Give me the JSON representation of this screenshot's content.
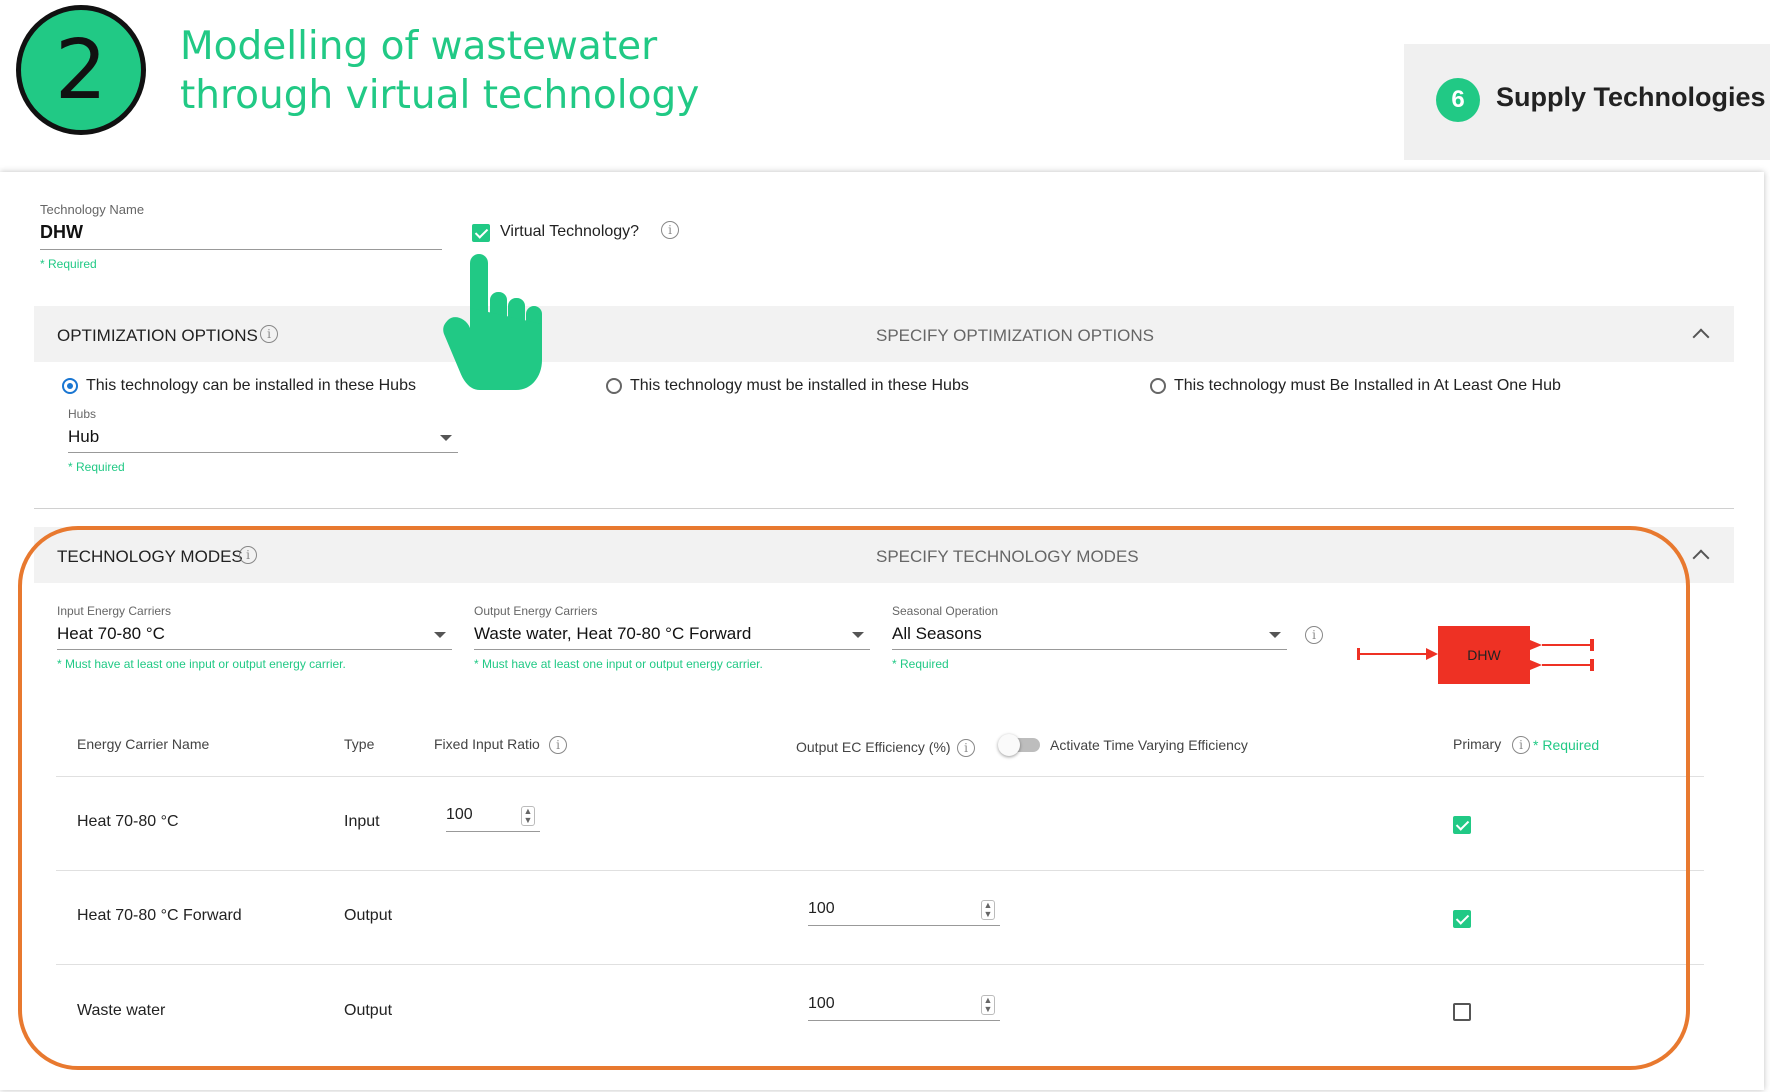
{
  "banner": {
    "step_number": "2",
    "title_line1": "Modelling of wastewater",
    "title_line2": "through virtual technology",
    "section_number": "6",
    "section_label": "Supply Technologies"
  },
  "technology": {
    "name_label": "Technology Name",
    "name_value": "DHW",
    "required": "* Required",
    "virtual_label": "Virtual Technology?",
    "virtual_checked": true
  },
  "optimization": {
    "title": "OPTIMIZATION OPTIONS",
    "center_label": "SPECIFY OPTIMIZATION OPTIONS",
    "options": [
      "This technology can be installed in these Hubs",
      "This technology must be installed in these Hubs",
      "This technology must Be Installed in At Least One Hub"
    ],
    "selected_option": 0,
    "hubs_label": "Hubs",
    "hubs_value": "Hub",
    "required": "* Required"
  },
  "modes": {
    "title": "TECHNOLOGY MODES",
    "center_label": "SPECIFY TECHNOLOGY MODES",
    "input_label": "Input Energy Carriers",
    "input_value": "Heat 70-80 °C",
    "input_hint": "* Must have at least one input or output energy carrier.",
    "output_label": "Output Energy Carriers",
    "output_value": "Waste water, Heat 70-80 °C Forward",
    "output_hint": "* Must have at least one input or output energy carrier.",
    "seasonal_label": "Seasonal Operation",
    "seasonal_value": "All Seasons",
    "seasonal_hint": "* Required",
    "diagram_label": "DHW",
    "diagram_color": "#ee3124"
  },
  "table": {
    "headers": {
      "name": "Energy Carrier Name",
      "type": "Type",
      "ratio": "Fixed Input Ratio",
      "efficiency": "Output EC Efficiency (%)",
      "time_varying": "Activate Time Varying Efficiency",
      "primary": "Primary",
      "required": "* Required"
    },
    "rows": [
      {
        "name": "Heat 70-80 °C",
        "type": "Input",
        "ratio": "100",
        "efficiency": "",
        "primary": true
      },
      {
        "name": "Heat 70-80 °C Forward",
        "type": "Output",
        "ratio": "",
        "efficiency": "100",
        "primary": true
      },
      {
        "name": "Waste water",
        "type": "Output",
        "ratio": "",
        "efficiency": "100",
        "primary": false
      }
    ]
  },
  "colors": {
    "accent": "#21c985",
    "highlight": "#e8792f",
    "radio": "#1976d2"
  }
}
